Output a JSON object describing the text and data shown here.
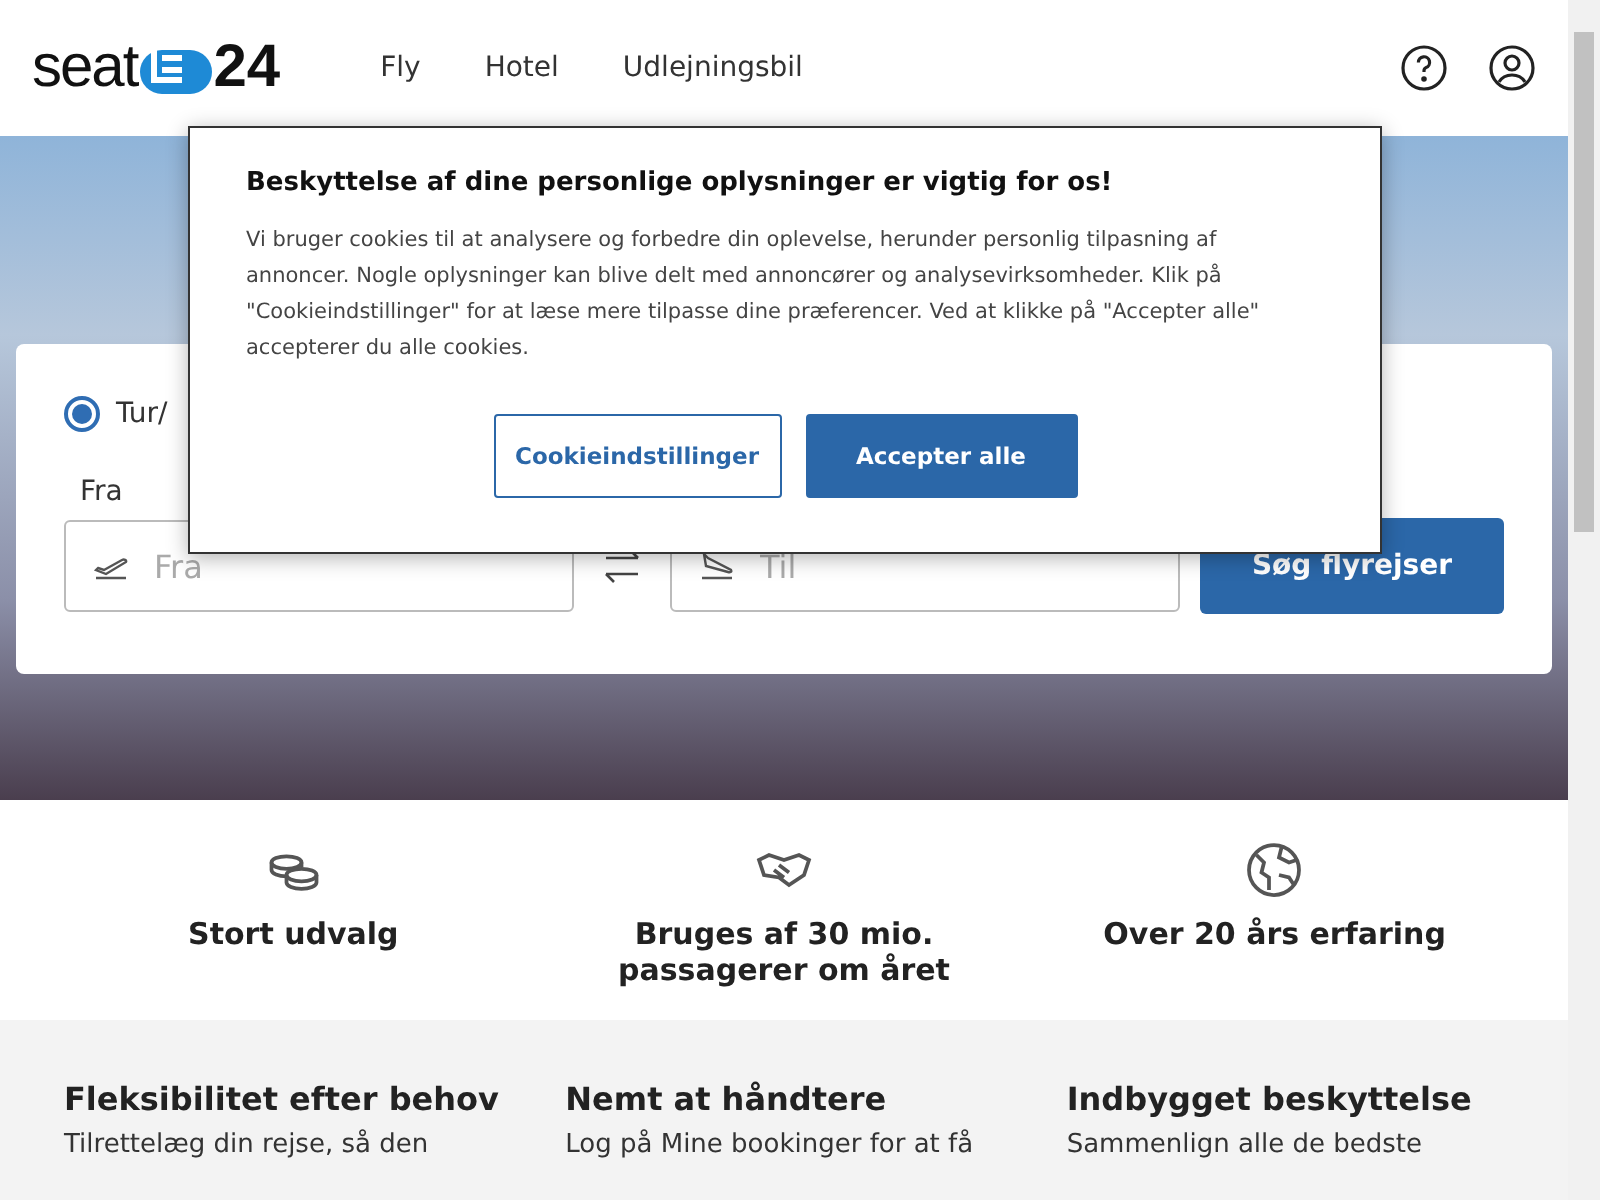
{
  "header": {
    "logo": {
      "word": "seat",
      "number": "24"
    },
    "nav": [
      {
        "label": "Fly"
      },
      {
        "label": "Hotel"
      },
      {
        "label": "Udlejningsbil"
      }
    ]
  },
  "search": {
    "trip_types": [
      {
        "label": "Tur/",
        "selected": true
      }
    ],
    "from": {
      "label": "Fra",
      "placeholder": "Fra"
    },
    "to": {
      "placeholder": "Til"
    },
    "button": "Søg flyrejser"
  },
  "features": [
    {
      "kind": "coins",
      "title": "Stort udvalg"
    },
    {
      "kind": "handshake",
      "title": "Bruges af 30 mio. passagerer om året"
    },
    {
      "kind": "globe",
      "title": "Over 20 års erfaring"
    }
  ],
  "benefits": [
    {
      "title": "Fleksibilitet efter behov",
      "text": "Tilrettelæg din rejse, så den"
    },
    {
      "title": "Nemt at håndtere",
      "text": "Log på Mine bookinger for at få"
    },
    {
      "title": "Indbygget beskyttelse",
      "text": "Sammenlign alle de bedste"
    }
  ],
  "cookie_dialog": {
    "title": "Beskyttelse af dine personlige oplysninger er vigtig for os!",
    "text": "Vi bruger cookies til at analysere og forbedre din oplevelse, herunder personlig tilpasning af annoncer. Nogle oplysninger kan blive delt med annoncører og analysevirksomheder. Klik på \"Cookieindstillinger\" for at læse mere tilpasse dine præferencer. Ved at klikke på \"Accepter alle\" accepterer du alle cookies.",
    "buttons": [
      {
        "kind": "secondary",
        "label": "Cookieindstillinger"
      },
      {
        "kind": "primary",
        "label": "Accepter alle"
      }
    ]
  }
}
